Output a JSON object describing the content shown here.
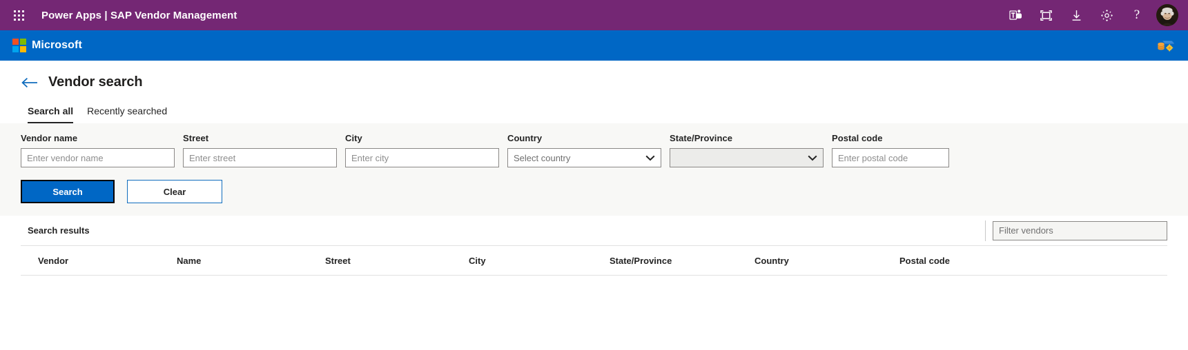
{
  "topbar": {
    "waffle_label": "app-launcher",
    "product": "Power Apps",
    "separator": "|",
    "app_name": "SAP Vendor Management",
    "title_full": "Power Apps  |  SAP Vendor Management",
    "icons": [
      {
        "name": "teams-icon",
        "label": "Teams"
      },
      {
        "name": "fullscreen-icon",
        "label": "Full screen"
      },
      {
        "name": "download-icon",
        "label": "Download"
      },
      {
        "name": "gear-icon",
        "label": "Settings"
      },
      {
        "name": "help-icon",
        "label": "?"
      }
    ],
    "avatar_label": "user-avatar",
    "background": "#742774"
  },
  "brandbar": {
    "logo_name": "microsoft-logo",
    "brand": "Microsoft",
    "background": "#0067c5",
    "right_icon": {
      "name": "data-settings-icon",
      "label": "Data settings"
    },
    "logo_colors": [
      "#f25022",
      "#7fba00",
      "#00a4ef",
      "#ffb900"
    ]
  },
  "header": {
    "back_label": "Back",
    "title": "Vendor search"
  },
  "tabs": [
    {
      "label": "Search all",
      "active": true
    },
    {
      "label": "Recently searched",
      "active": false
    }
  ],
  "search_form": {
    "fields": [
      {
        "key": "vendor_name",
        "label": "Vendor name",
        "type": "text",
        "value": "",
        "placeholder": "Enter vendor name"
      },
      {
        "key": "street",
        "label": "Street",
        "type": "text",
        "value": "",
        "placeholder": "Enter street"
      },
      {
        "key": "city",
        "label": "City",
        "type": "text",
        "value": "",
        "placeholder": "Enter city"
      },
      {
        "key": "country",
        "label": "Country",
        "type": "select",
        "value": "Select country",
        "disabled": false
      },
      {
        "key": "state_province",
        "label": "State/Province",
        "type": "select",
        "value": "",
        "disabled": true
      },
      {
        "key": "postal_code",
        "label": "Postal code",
        "type": "text",
        "value": "",
        "placeholder": "Enter postal code"
      }
    ],
    "buttons": {
      "search": "Search",
      "clear": "Clear"
    },
    "accent_color": "#0067c5",
    "panel_background": "#f8f8f6"
  },
  "results": {
    "title": "Search results",
    "filter_placeholder": "Filter vendors",
    "filter_value": "",
    "columns": [
      "Vendor",
      "Name",
      "Street",
      "City",
      "State/Province",
      "Country",
      "Postal code"
    ],
    "rows": []
  }
}
